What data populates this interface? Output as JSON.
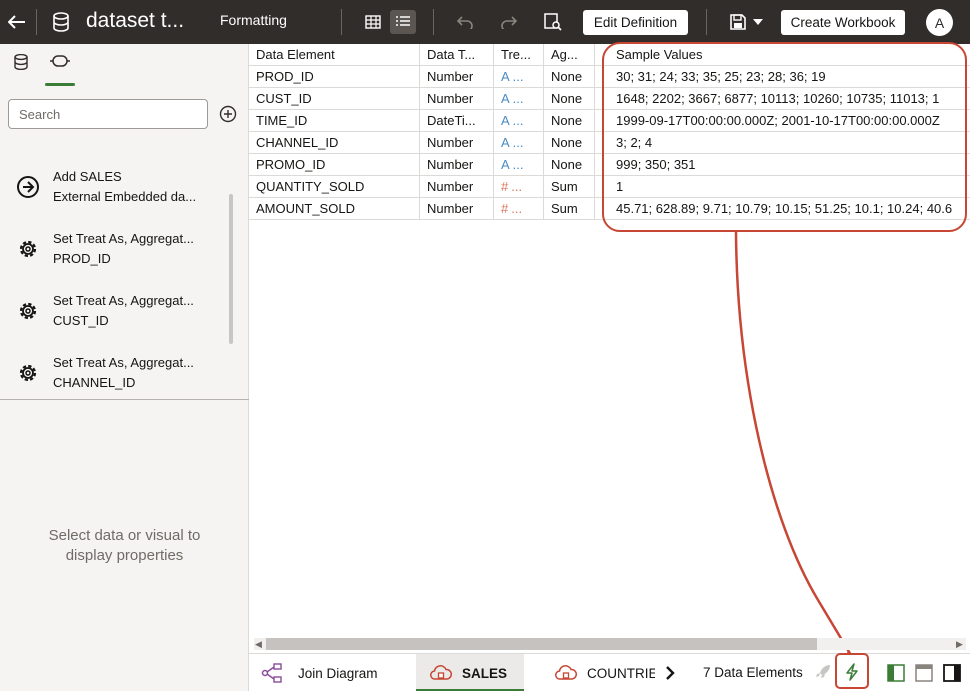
{
  "header": {
    "title": "dataset t...",
    "formatting_label": "Formatting",
    "edit_definition_label": "Edit Definition",
    "create_workbook_label": "Create Workbook",
    "avatar_initial": "A"
  },
  "left_panel": {
    "search": {
      "placeholder": "Search",
      "value": ""
    },
    "history": [
      {
        "icon": "arrow-right-circle-icon",
        "line1": "Add SALES",
        "line2": "External Embedded da..."
      },
      {
        "icon": "gear-icon",
        "line1": "Set Treat As, Aggregat...",
        "line2": "PROD_ID"
      },
      {
        "icon": "gear-icon",
        "line1": "Set Treat As, Aggregat...",
        "line2": "CUST_ID"
      },
      {
        "icon": "gear-icon",
        "line1": "Set Treat As, Aggregat...",
        "line2": "CHANNEL_ID"
      }
    ],
    "properties_message": "Select data or visual to display properties"
  },
  "grid": {
    "columns": [
      "Data Element",
      "Data T...",
      "Tre...",
      "Ag...",
      "Sample Values"
    ],
    "rows": [
      {
        "element": "PROD_ID",
        "type": "Number",
        "treat_icon": "A",
        "treat": "...",
        "agg": "None",
        "samples": "30; 31; 24; 33; 35; 25; 23; 28; 36; 19"
      },
      {
        "element": "CUST_ID",
        "type": "Number",
        "treat_icon": "A",
        "treat": "...",
        "agg": "None",
        "samples": "1648; 2202; 3667; 6877; 10113; 10260; 10735; 11013; 1"
      },
      {
        "element": "TIME_ID",
        "type": "DateTi...",
        "treat_icon": "A",
        "treat": "...",
        "agg": "None",
        "samples": "1999-09-17T00:00:00.000Z; 2001-10-17T00:00:00.000Z"
      },
      {
        "element": "CHANNEL_ID",
        "type": "Number",
        "treat_icon": "A",
        "treat": "...",
        "agg": "None",
        "samples": "3; 2; 4"
      },
      {
        "element": "PROMO_ID",
        "type": "Number",
        "treat_icon": "A",
        "treat": "...",
        "agg": "None",
        "samples": "999; 350; 351"
      },
      {
        "element": "QUANTITY_SOLD",
        "type": "Number",
        "treat_icon": "#",
        "treat": "...",
        "agg": "Sum",
        "samples": "1"
      },
      {
        "element": "AMOUNT_SOLD",
        "type": "Number",
        "treat_icon": "#",
        "treat": "...",
        "agg": "Sum",
        "samples": "45.71; 628.89; 9.71; 10.79; 10.15; 51.25; 10.1; 10.24; 40.6"
      }
    ]
  },
  "bottom": {
    "tabs": [
      {
        "label": "Join Diagram",
        "icon": "join-diagram-icon"
      },
      {
        "label": "SALES",
        "icon": "cloud-database-icon"
      },
      {
        "label": "COUNTRIE",
        "icon": "cloud-database-icon"
      }
    ],
    "elements_count": "7 Data Elements"
  },
  "colors": {
    "header_bg": "#312d2a",
    "accent_green": "#3b7d37",
    "callout_red": "#c74634",
    "treat_attribute_blue": "#4a8bc2",
    "treat_measure_orange": "#d9735c"
  }
}
